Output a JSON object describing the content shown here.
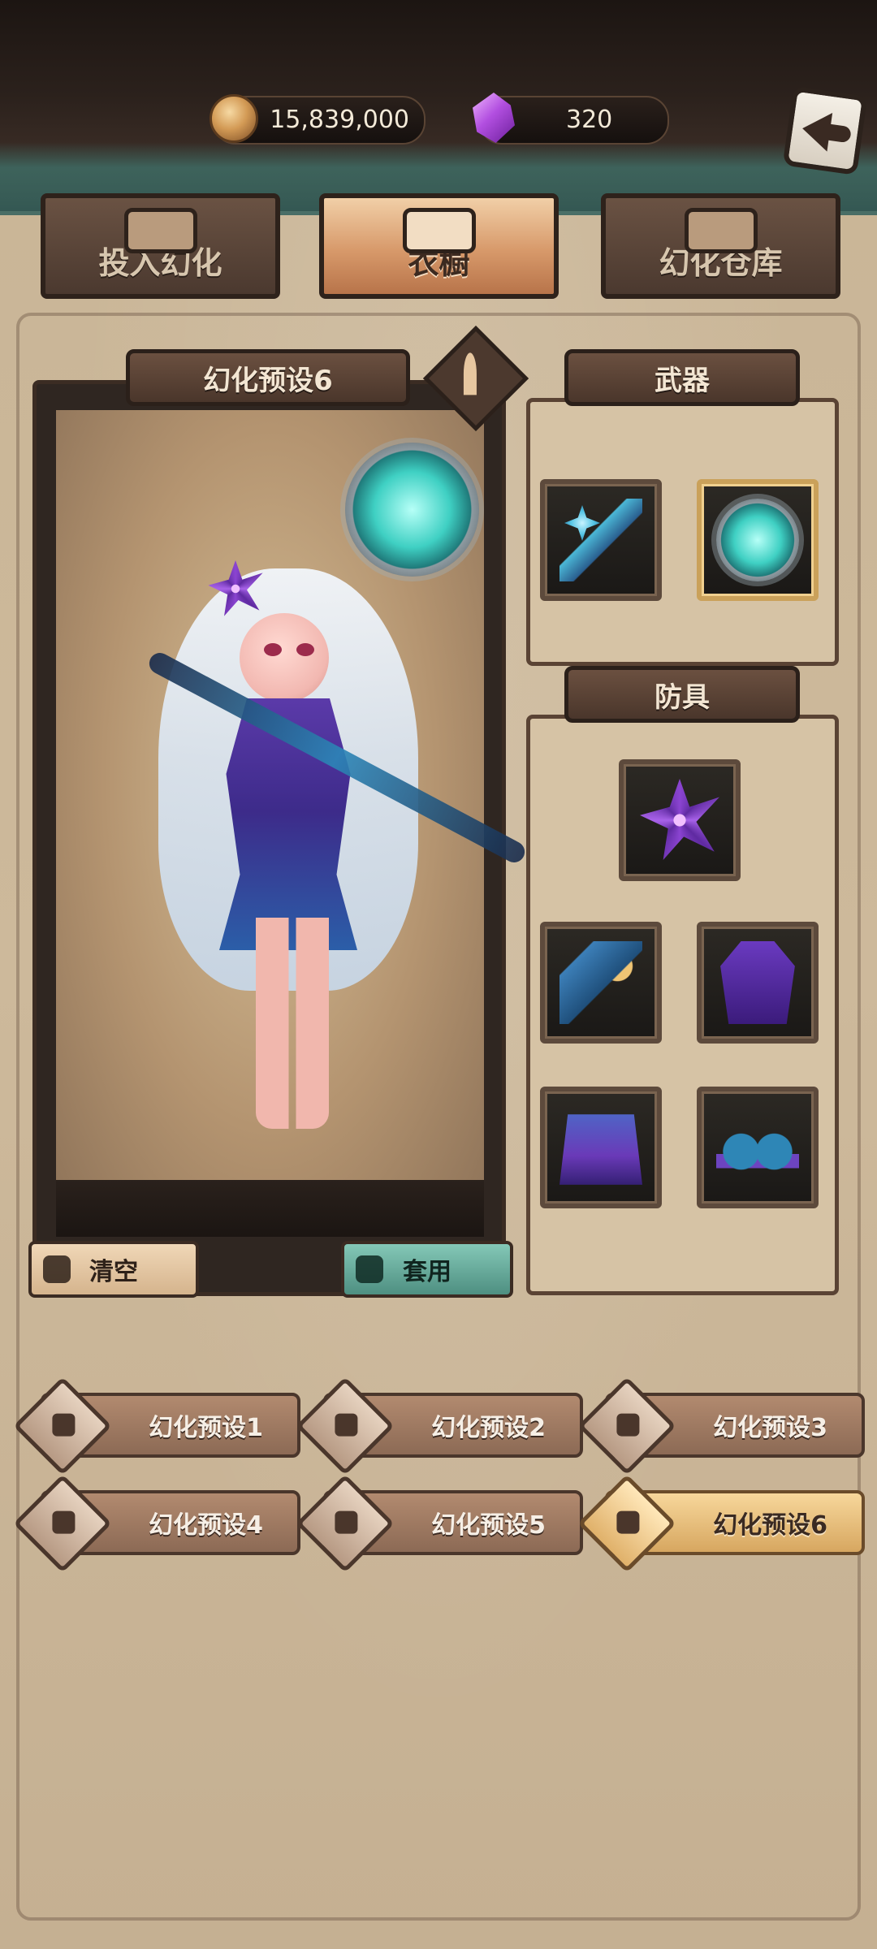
{
  "currency": {
    "gold_value": "15,839,000",
    "gem_value": "320",
    "gold_icon": "coin-icon",
    "gem_icon": "crystal-icon"
  },
  "tabs": [
    {
      "label": "投入幻化",
      "icon": "mask-icon"
    },
    {
      "label": "衣橱",
      "icon": "wardrobe-icon"
    },
    {
      "label": "幻化仓库",
      "icon": "warehouse-icon"
    }
  ],
  "preview": {
    "preset_title": "幻化预设6",
    "edit_icon": "quill-icon"
  },
  "sections": {
    "weapon_title": "武器",
    "armor_title": "防具"
  },
  "actions": {
    "clear_label": "清空",
    "apply_label": "套用",
    "clear_icon": "trash-icon",
    "apply_icon": "crown-icon"
  },
  "presets": [
    {
      "label": "幻化预设1"
    },
    {
      "label": "幻化预设2"
    },
    {
      "label": "幻化预设3"
    },
    {
      "label": "幻化预设4"
    },
    {
      "label": "幻化预设5"
    },
    {
      "label": "幻化预设6"
    }
  ],
  "colors": {
    "accent_gold": "#d7a760",
    "tab_active": "#d7996a",
    "apply_teal": "#4e8f81"
  }
}
